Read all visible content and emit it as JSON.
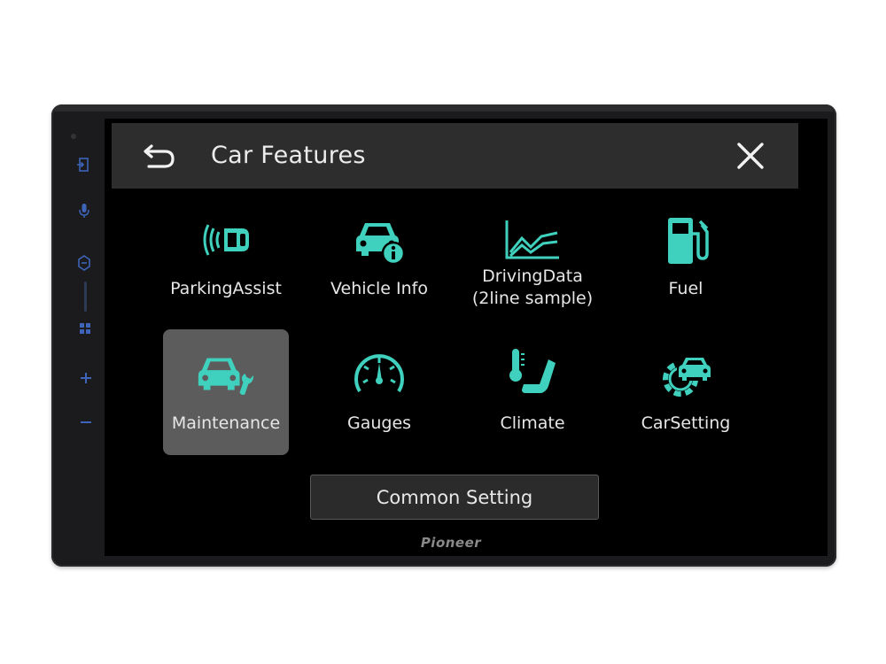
{
  "header": {
    "title": "Car Features",
    "back_icon": "back-arrow-icon",
    "close_icon": "close-icon"
  },
  "features": [
    {
      "id": "parking-assist",
      "label": "ParkingAssist",
      "icon": "parking-sensor-icon",
      "selected": false
    },
    {
      "id": "vehicle-info",
      "label": "Vehicle Info",
      "icon": "car-info-icon",
      "selected": false
    },
    {
      "id": "driving-data",
      "label_line1": "DrivingData",
      "label_line2": "(2line sample)",
      "icon": "line-chart-icon",
      "selected": false
    },
    {
      "id": "fuel",
      "label": "Fuel",
      "icon": "fuel-pump-icon",
      "selected": false
    },
    {
      "id": "maintenance",
      "label": "Maintenance",
      "icon": "car-wrench-icon",
      "selected": true
    },
    {
      "id": "gauges",
      "label": "Gauges",
      "icon": "speedometer-icon",
      "selected": false
    },
    {
      "id": "climate",
      "label": "Climate",
      "icon": "thermometer-seat-icon",
      "selected": false
    },
    {
      "id": "car-setting",
      "label": "CarSetting",
      "icon": "car-gear-icon",
      "selected": false
    }
  ],
  "common_setting": {
    "label": "Common Setting"
  },
  "brand": {
    "name": "Pioneer"
  },
  "side_buttons": [
    {
      "icon": "source-icon"
    },
    {
      "icon": "microphone-icon"
    },
    {
      "icon": "navigation-icon"
    },
    {
      "icon": "apps-grid-icon"
    },
    {
      "icon": "volume-up-icon"
    },
    {
      "icon": "volume-down-icon"
    }
  ],
  "colors": {
    "accent": "#3fd1bd",
    "title_bar": "#2d2d2d",
    "selected_tile": "#5c5c5c",
    "side_icons": "#3d64b8"
  }
}
